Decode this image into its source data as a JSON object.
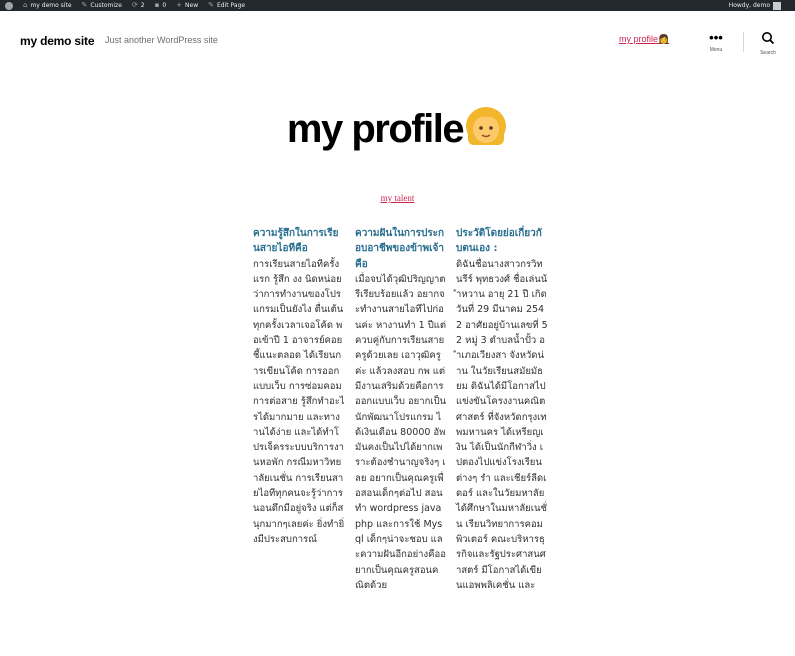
{
  "adminbar": {
    "site": "my demo site",
    "customize": "Customize",
    "updates_count": "2",
    "comments_count": "0",
    "new": "New",
    "edit_page": "Edit Page",
    "howdy": "Howdy, demo"
  },
  "header": {
    "site_title": "my demo site",
    "tagline": "Just another WordPress site",
    "nav_link": "my profile",
    "nav_emoji": "👩",
    "menu_label": "Menu",
    "search_label": "Search"
  },
  "page": {
    "title": "my profile",
    "talent_link": "my talent"
  },
  "columns": [
    {
      "heading": "ความรู้สึกในการเรียนสายไอทีคือ",
      "body": "การเรียนสายไอทีครั้งแรก รู้สึก งง นิดหน่อยว่าการทำงานของโปรแกรมเป็นยังไง ตื่นเต้นทุกครั้งเวลาเจอโค้ด พอเข้าปี 1 อาจารย์คอยชี้แนะตลอด ได้เรียนการเขียนโค้ด การออกแบบเว็บ การซ่อมคอม การต่อสาย รู้สึกทำอะไรได้มากมาย และทางานได้ง่าย และได้ทำโปรเจ็ครระบบบริการงานหอพัก กรณีมหาวิทยาลัยเนชั่น การเรียนสายไอทีทุกคนจะรู้ว่าการนอนดึกมีอยู่จริง แต่ก็สนุกมากๆเลยค่ะ ยิ่งทำยิ่งมีประสบการณ์"
    },
    {
      "heading": "ความฝันในการประกอบอาชีพของข้าพเจ้าคือ",
      "body": "เมื่อจบได้วุฒิปริญญาตรีเรียบร้อยแล้ว อยากจะทำงานสายไอทีไปก่อนค่ะ หางานทำ 1 ปีแต่ควบคู่กับการเรียนสายครูด้วยเลย เอาวุฒิครูค่ะ แล้วลงสอบ กพ แต่มีงานเสริมด้วยคือการออกแบบเว็บ อยากเป็นนักพัฒนาโปรแกรม ได้เงินเดือน 80000 อัพ มันคงเป็นไปได้ยากเพราะต้องชำนาญจริงๆ เลย อยากเป็นคุณครูเพื่อสอนเด็กๆต่อไป สอนทำ wordpress java php และการใช้ Mysql เด็กๆน่าจะชอบ และความฝันอีกอย่างคืออยากเป็นคุณครูสอนคณิตด้วย"
    },
    {
      "heading": "ประวัติโดยย่อเกี่ยวกับตนเอง :",
      "body": "ดิฉันชื่อนางสาวกรวิทนรีร์ พุทธวงศ์ ชื่อเล่นน้ำหวาน อายุ 21 ปี เกิดวันที่ 29 มีนาคม 2542 อาศัยอยู่บ้านเลขที่ 52 หมู่ 3 ตำบลน้ำปั้ว อำเภอเวียงสา จังหวัดน่าน ในวัยเรียนสมัยมัธยม ดิฉันได้มีโอกาสไปแข่งขันโครงงานคณิตศาสตร์ ที่จังหวัดกรุงเทพมหานคร ได้เหรียญเงิน ได้เป็นนักกีฬาวิ่ง เปตองไปแข่งโรงเรียนต่างๆ รำ และเชียร์ลีดเดอร์ และในวัยมหาลัยได้ศึกษาในมหาลัยเนชั่น เรียนวิทยาการคอมพิวเตอร์ คณะบริหารธุรกิจและรัฐประศาสนศาสตร์ มีโอกาสได้เขียนแอพพลิเคชั่น และ"
    }
  ]
}
